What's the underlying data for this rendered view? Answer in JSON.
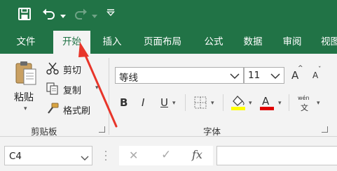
{
  "ribbon_tabs": [
    "文件",
    "开始",
    "插入",
    "页面布局",
    "公式",
    "数据",
    "审阅",
    "视图"
  ],
  "clipboard": {
    "paste_label": "粘贴",
    "cut_label": "剪切",
    "copy_label": "复制",
    "format_painter_label": "格式刷",
    "group_label": "剪贴板"
  },
  "font": {
    "font_name": "等线",
    "font_size": "11",
    "bold": "B",
    "italic": "I",
    "underline": "U",
    "increase_size": "A",
    "decrease_size": "A",
    "phonetic_top": "wén",
    "phonetic_bottom": "文",
    "group_label": "字体",
    "colors": {
      "highlight": "#FFFF00",
      "font_color": "#E00000"
    }
  },
  "formula_bar": {
    "name_box": "C4",
    "cancel": "✕",
    "enter": "✓",
    "insert_function": "fx",
    "content": ""
  },
  "annotation": {
    "arrow_color": "#E8352A"
  },
  "icons": [
    "save-icon",
    "undo-icon",
    "redo-icon",
    "customize-qat-icon",
    "paste-icon",
    "cut-icon",
    "copy-icon",
    "format-painter-icon",
    "border-icon",
    "fill-color-icon",
    "font-color-icon",
    "phonetic-icon"
  ]
}
